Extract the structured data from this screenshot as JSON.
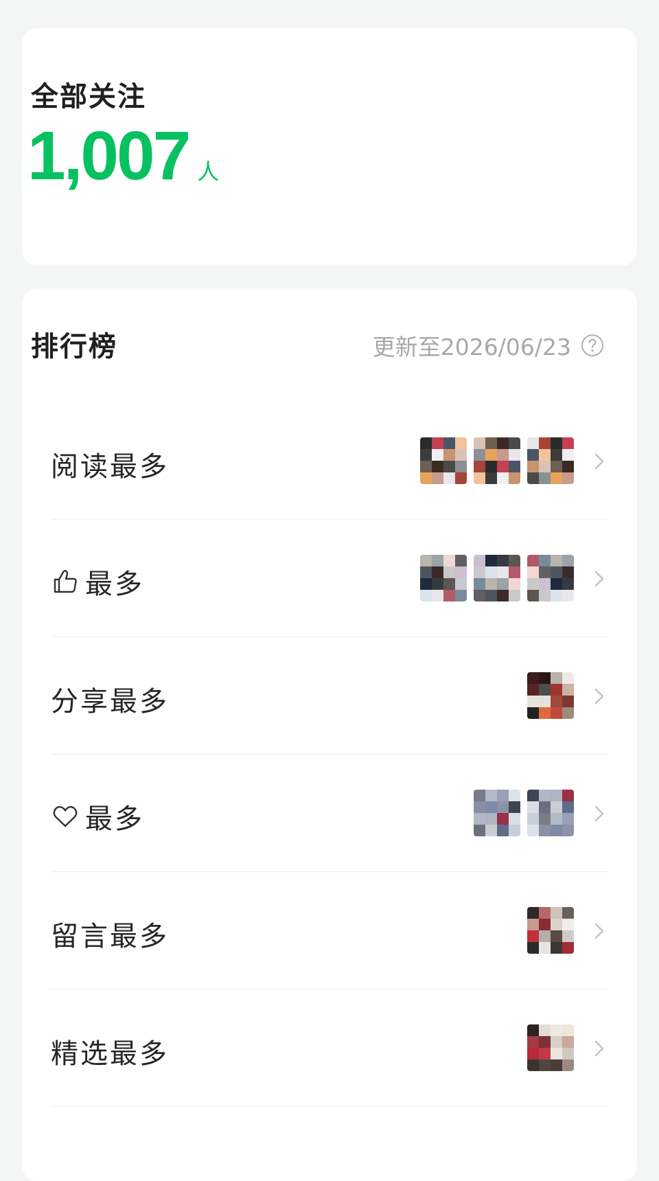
{
  "summary": {
    "title": "全部关注",
    "count": "1,007",
    "unit": "人"
  },
  "ranking": {
    "title": "排行榜",
    "updated": "更新至2026/06/23",
    "rows": [
      {
        "label": "阅读最多",
        "icon": "none",
        "avatars": 3
      },
      {
        "label": "最多",
        "icon": "thumbs-up-icon",
        "avatars": 3
      },
      {
        "label": "分享最多",
        "icon": "none",
        "avatars": 1
      },
      {
        "label": "最多",
        "icon": "heart-icon",
        "avatars": 2
      },
      {
        "label": "留言最多",
        "icon": "none",
        "avatars": 1
      },
      {
        "label": "精选最多",
        "icon": "none",
        "avatars": 1
      }
    ]
  },
  "colors": {
    "accent": "#07c160",
    "muted_text": "#a8a8a8",
    "background": "#f4f5f5"
  }
}
